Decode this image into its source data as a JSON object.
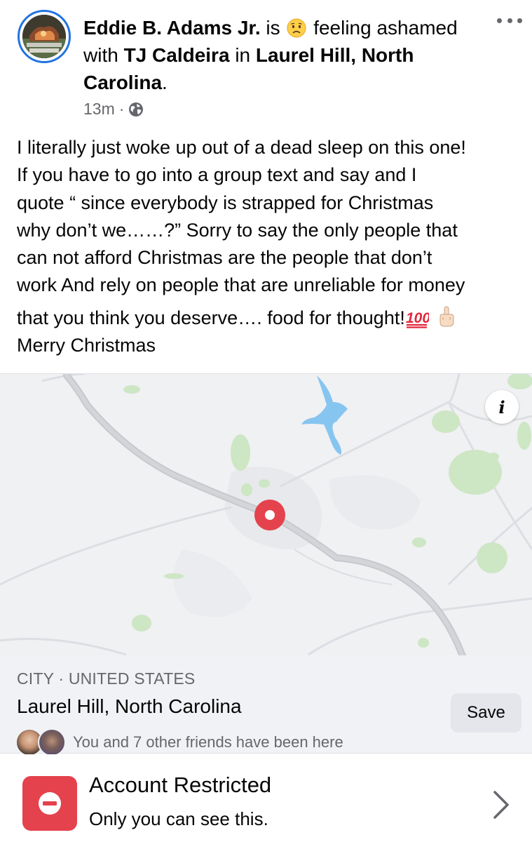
{
  "post": {
    "author": "Eddie B. Adams Jr.",
    "is_text": "is",
    "feeling_emoji_icon": "sad-face-emoji-icon",
    "feeling_text": "feeling ashamed",
    "with_text": "with",
    "tagged_friend": "TJ Caldeira",
    "in_text": "in",
    "location_line1": "Laurel Hill, North",
    "location_line2": "Carolina",
    "period": ".",
    "time": "13m",
    "separator": "·",
    "privacy_icon": "globe-icon",
    "more_icon": "more-options-icon",
    "body_lines": [
      "I literally just woke up out of a dead sleep on this one!",
      "If you have to go into a group text and say and I",
      "quote “ since everybody is strapped for Christmas",
      "why don’t we……?” Sorry to say the only people that",
      "can not afford Christmas are the people that don’t",
      "work And rely on people that are unreliable for money",
      "that you think you deserve…. food for thought!"
    ],
    "body_emojis": [
      "hundred-points-emoji-icon",
      "middle-finger-emoji-icon"
    ],
    "body_last_line": "Merry Christmas"
  },
  "map": {
    "info_label": "i",
    "pin_color": "#e4424d",
    "water_color": "#86c5f0",
    "park_color": "#cde6c4"
  },
  "place": {
    "category": "CITY · UNITED STATES",
    "name": "Laurel Hill, North Carolina",
    "save_label": "Save",
    "friends_text": "You and 7 other friends have been here"
  },
  "restriction": {
    "icon": "no-entry-icon",
    "title": "Account Restricted",
    "subtitle": "Only you can see this.",
    "accent": "#e4424d"
  }
}
